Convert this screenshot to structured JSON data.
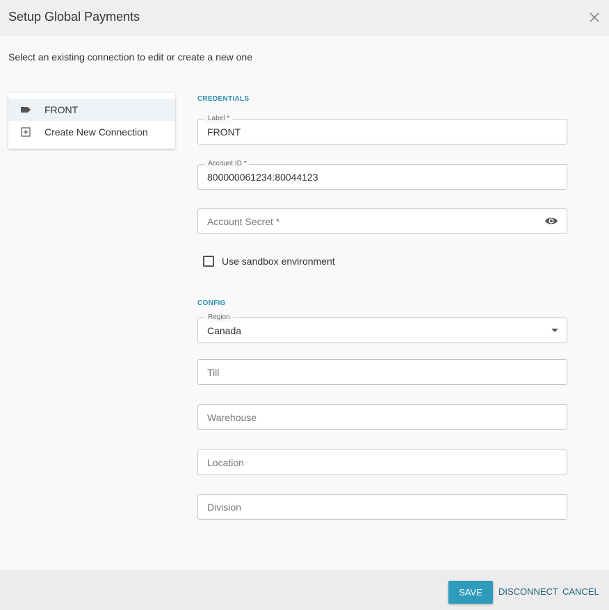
{
  "dialog": {
    "title": "Setup Global Payments",
    "subtitle": "Select an existing connection to edit or create a new one"
  },
  "connections": {
    "items": [
      {
        "label": "FRONT",
        "icon": "label-tag-icon",
        "selected": true
      },
      {
        "label": "Create New Connection",
        "icon": "add-box-icon",
        "selected": false
      }
    ]
  },
  "credentials": {
    "section_title": "CREDENTIALS",
    "label_field": {
      "label": "Label *",
      "value": "FRONT"
    },
    "account_id_field": {
      "label": "Account ID *",
      "value": "800000061234:80044123"
    },
    "account_secret_field": {
      "placeholder": "Account Secret *",
      "icon": "eye-icon"
    },
    "sandbox_checkbox": {
      "label": "Use sandbox environment",
      "checked": false
    }
  },
  "config": {
    "section_title": "CONFIG",
    "region_field": {
      "label": "Region",
      "value": "Canada"
    },
    "till_field": {
      "placeholder": "Till"
    },
    "warehouse_field": {
      "placeholder": "Warehouse"
    },
    "location_field": {
      "placeholder": "Location"
    },
    "division_field": {
      "placeholder": "Division"
    }
  },
  "footer": {
    "save_label": "SAVE",
    "disconnect_label": "DISCONNECT",
    "cancel_label": "CANCEL"
  },
  "colors": {
    "accent": "#2e9bbd",
    "section_title": "#2e8fb0",
    "selected_row": "#eef2f5"
  }
}
